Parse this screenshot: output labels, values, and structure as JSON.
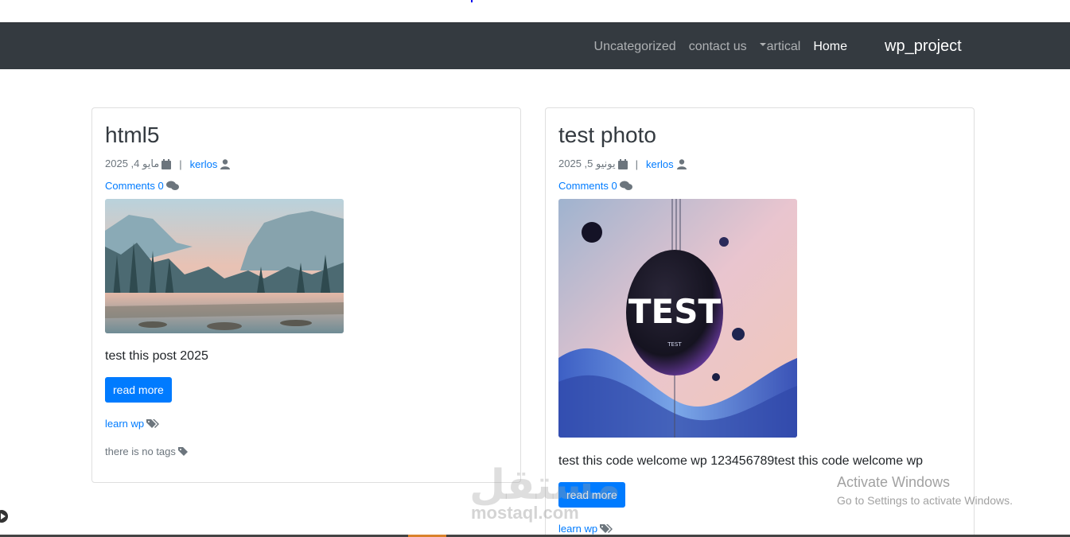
{
  "navbar": {
    "brand": "wp_project",
    "links": [
      "Uncategorized",
      "contact us",
      "artical",
      "Home"
    ]
  },
  "posts": [
    {
      "title": "html5",
      "date": "مايو 4, 2025",
      "author": "kerlos",
      "comments": "Comments 0",
      "excerpt": "test this post 2025",
      "button": "read more",
      "category": "learn wp",
      "tags": "there is no tags"
    },
    {
      "title": "test photo",
      "date": "يونيو 5, 2025",
      "author": "kerlos",
      "comments": "Comments 0",
      "image_text": "TEST",
      "image_subtext": "TEST",
      "excerpt": "test this code welcome wp 123456789test this code welcome wp",
      "button": "read more",
      "category": "learn wp"
    }
  ],
  "overlay": {
    "watermark": "مستقل",
    "watermark_sub": "mostaql.com",
    "activate_title": "Activate Windows",
    "activate_sub": "Go to Settings to activate Windows."
  },
  "colors": {
    "navbar": "#343a40",
    "link": "#007bff",
    "button": "#007bff"
  }
}
